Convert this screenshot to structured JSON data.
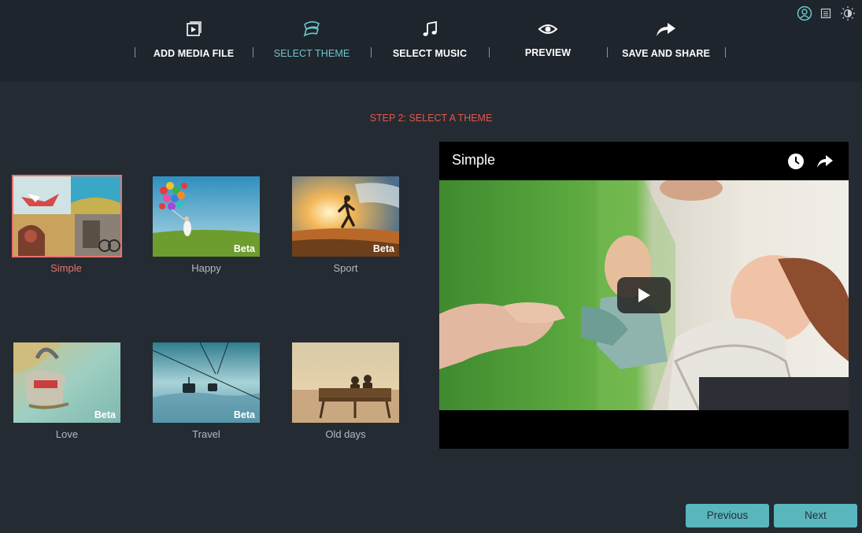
{
  "toolbar": {
    "steps": [
      {
        "label": "ADD MEDIA FILE",
        "icon": "add-media-icon"
      },
      {
        "label": "SELECT THEME",
        "icon": "theme-icon",
        "active": true
      },
      {
        "label": "SELECT MUSIC",
        "icon": "music-note-icon"
      },
      {
        "label": "PREVIEW",
        "icon": "eye-icon"
      },
      {
        "label": "SAVE AND SHARE",
        "icon": "share-arrow-icon"
      }
    ],
    "utilities": [
      "account-icon",
      "menu-icon",
      "brightness-icon"
    ],
    "active_color": "#6bc7cf"
  },
  "heading": "STEP 2: SELECT A THEME",
  "themes": [
    {
      "name": "Simple",
      "beta": "",
      "selected": true
    },
    {
      "name": "Happy",
      "beta": "Beta"
    },
    {
      "name": "Sport",
      "beta": "Beta"
    },
    {
      "name": "Love",
      "beta": "Beta"
    },
    {
      "name": "Travel",
      "beta": "Beta"
    },
    {
      "name": "Old days",
      "beta": ""
    }
  ],
  "preview": {
    "title": "Simple",
    "icons": [
      "clock-icon",
      "share-icon",
      "play-icon"
    ]
  },
  "buttons": {
    "previous": "Previous",
    "next": "Next"
  },
  "colors": {
    "accent": "#e9736a",
    "button": "#5ab6bd",
    "background": "#252b33"
  }
}
